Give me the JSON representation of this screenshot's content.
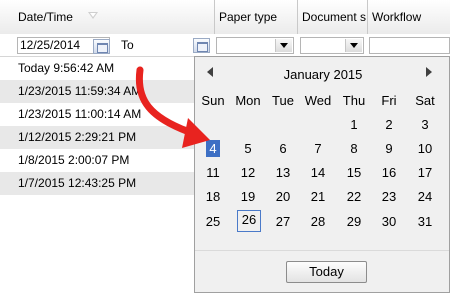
{
  "columns": [
    "Date/Time",
    "Paper type",
    "Document s",
    "Workflow"
  ],
  "filter": {
    "date_from": "12/25/2014",
    "to_label": "To"
  },
  "rows": [
    "Today 9:56:42 AM",
    "1/23/2015 11:59:34 AM",
    "1/23/2015 11:00:14 AM",
    "1/12/2015 2:29:21 PM",
    "1/8/2015 2:00:07 PM",
    "1/7/2015 12:43:25 PM"
  ],
  "calendar": {
    "month_title": "January 2015",
    "weekdays": [
      "Sun",
      "Mon",
      "Tue",
      "Wed",
      "Thu",
      "Fri",
      "Sat"
    ],
    "weeks": [
      [
        "",
        "",
        "",
        "",
        "1",
        "2",
        "3"
      ],
      [
        "4",
        "5",
        "6",
        "7",
        "8",
        "9",
        "10"
      ],
      [
        "11",
        "12",
        "13",
        "14",
        "15",
        "16",
        "17"
      ],
      [
        "18",
        "19",
        "20",
        "21",
        "22",
        "23",
        "24"
      ],
      [
        "25",
        "26",
        "27",
        "28",
        "29",
        "30",
        "31"
      ]
    ],
    "selected_day": "4",
    "today_day": "26",
    "today_button": "Today"
  },
  "colors": {
    "accent": "#3d6fc4",
    "arrow": "#e8231f"
  }
}
